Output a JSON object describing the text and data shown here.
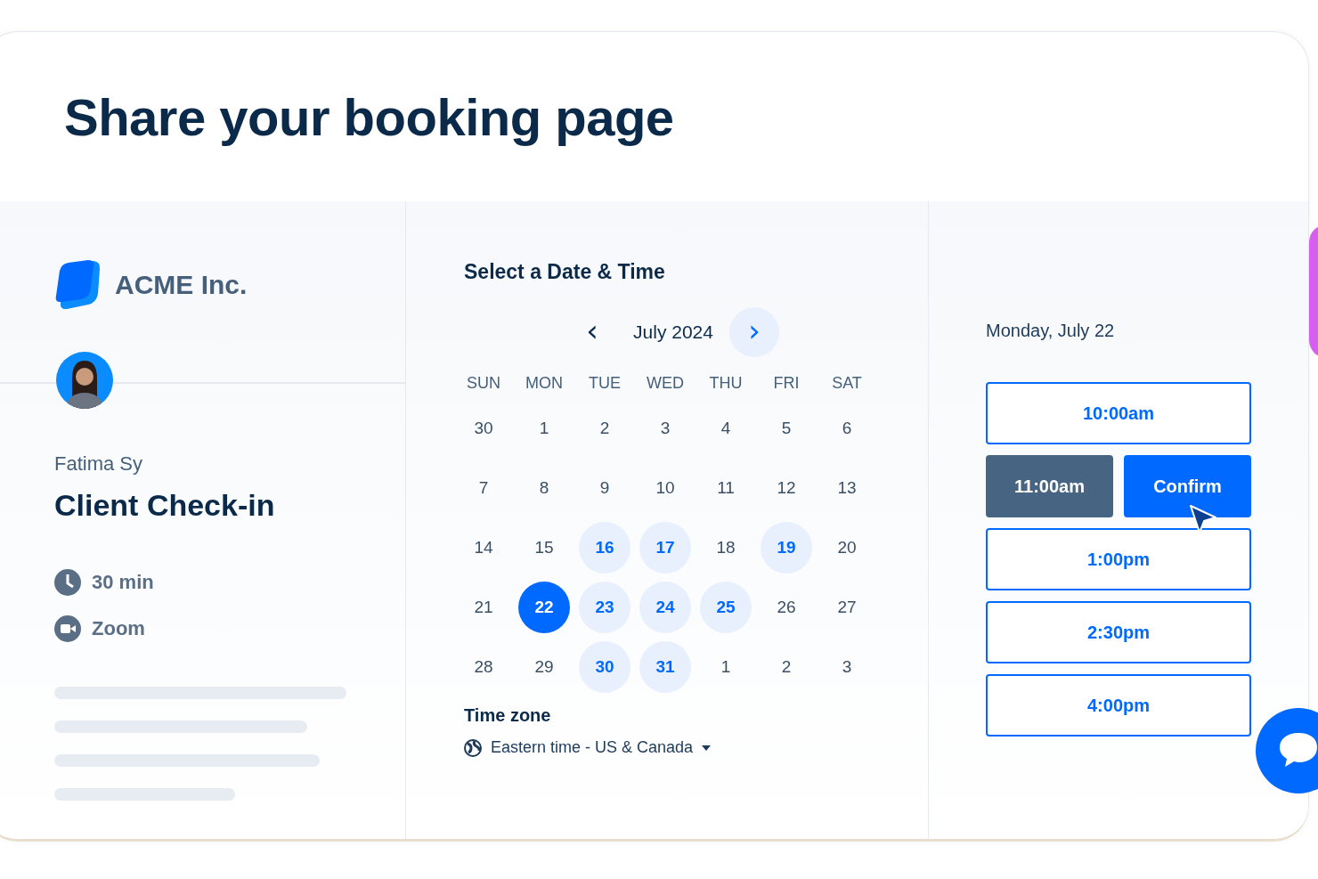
{
  "title": "Share your booking page",
  "host": {
    "company": "ACME Inc.",
    "name": "Fatima Sy",
    "event": "Client Check-in",
    "details": [
      {
        "kind": "duration",
        "label": "30 min"
      },
      {
        "kind": "video",
        "label": "Zoom"
      }
    ]
  },
  "calendar": {
    "heading": "Select a Date & Time",
    "month": "July 2024",
    "prev": "‹",
    "next": "›",
    "weekdays": [
      "SUN",
      "MON",
      "TUE",
      "WED",
      "THU",
      "FRI",
      "SAT"
    ],
    "days": [
      {
        "label": "30",
        "available": false,
        "selected": false
      },
      {
        "label": "1",
        "available": false,
        "selected": false
      },
      {
        "label": "2",
        "available": false,
        "selected": false
      },
      {
        "label": "3",
        "available": false,
        "selected": false
      },
      {
        "label": "4",
        "available": false,
        "selected": false
      },
      {
        "label": "5",
        "available": false,
        "selected": false
      },
      {
        "label": "6",
        "available": false,
        "selected": false
      },
      {
        "label": "7",
        "available": false,
        "selected": false
      },
      {
        "label": "8",
        "available": false,
        "selected": false
      },
      {
        "label": "9",
        "available": false,
        "selected": false
      },
      {
        "label": "10",
        "available": false,
        "selected": false
      },
      {
        "label": "11",
        "available": false,
        "selected": false
      },
      {
        "label": "12",
        "available": false,
        "selected": false
      },
      {
        "label": "13",
        "available": false,
        "selected": false
      },
      {
        "label": "14",
        "available": false,
        "selected": false
      },
      {
        "label": "15",
        "available": false,
        "selected": false
      },
      {
        "label": "16",
        "available": true,
        "selected": false
      },
      {
        "label": "17",
        "available": true,
        "selected": false
      },
      {
        "label": "18",
        "available": false,
        "selected": false
      },
      {
        "label": "19",
        "available": true,
        "selected": false
      },
      {
        "label": "20",
        "available": false,
        "selected": false
      },
      {
        "label": "21",
        "available": false,
        "selected": false
      },
      {
        "label": "22",
        "available": true,
        "selected": true
      },
      {
        "label": "23",
        "available": true,
        "selected": false
      },
      {
        "label": "24",
        "available": true,
        "selected": false
      },
      {
        "label": "25",
        "available": true,
        "selected": false
      },
      {
        "label": "26",
        "available": false,
        "selected": false
      },
      {
        "label": "27",
        "available": false,
        "selected": false
      },
      {
        "label": "28",
        "available": false,
        "selected": false
      },
      {
        "label": "29",
        "available": false,
        "selected": false
      },
      {
        "label": "30",
        "available": true,
        "selected": false
      },
      {
        "label": "31",
        "available": true,
        "selected": false
      },
      {
        "label": "1",
        "available": false,
        "selected": false
      },
      {
        "label": "2",
        "available": false,
        "selected": false
      },
      {
        "label": "3",
        "available": false,
        "selected": false
      }
    ],
    "timezone_label": "Time zone",
    "timezone": "Eastern time - US & Canada"
  },
  "slots": {
    "date": "Monday, July 22",
    "confirm": "Confirm",
    "times": [
      {
        "label": "10:00am",
        "selected": false
      },
      {
        "label": "11:00am",
        "selected": true
      },
      {
        "label": "1:00pm",
        "selected": false
      },
      {
        "label": "2:30pm",
        "selected": false
      },
      {
        "label": "4:00pm",
        "selected": false
      }
    ]
  }
}
